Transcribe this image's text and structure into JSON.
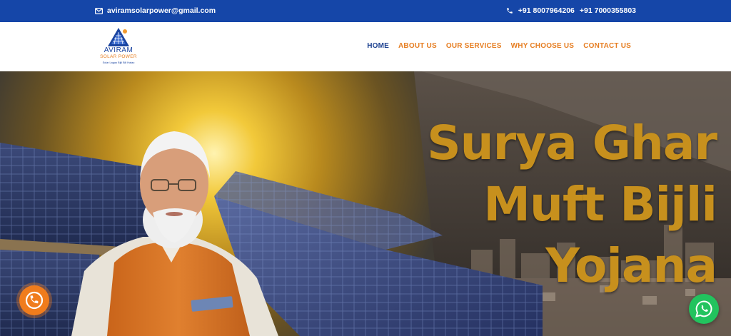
{
  "topbar": {
    "email": "aviramsolarpower@gmail.com",
    "phone1": "+91 8007964206",
    "phone2": "+91 7000355803",
    "email_icon": "envelope-icon",
    "phone_icon": "phone-icon"
  },
  "logo": {
    "name": "AVIRAM",
    "subtitle": "SOLAR POWER",
    "tagline": "Solar Lagao Bijli Bill Hatao"
  },
  "nav": {
    "items": [
      {
        "label": "HOME",
        "active": true
      },
      {
        "label": "ABOUT US",
        "active": false
      },
      {
        "label": "OUR SERVICES",
        "active": false
      },
      {
        "label": "WHY CHOOSE US",
        "active": false
      },
      {
        "label": "CONTACT US",
        "active": false
      }
    ]
  },
  "hero": {
    "title_line1": "Surya Ghar",
    "title_line2": "Muft Bijli",
    "title_line3": "Yojana"
  },
  "floating": {
    "call_icon": "phone-call-icon",
    "whatsapp_icon": "whatsapp-icon"
  },
  "colors": {
    "topbar_bg": "#1546a8",
    "nav_active": "#1a3f8f",
    "nav_link": "#e67e22",
    "hero_title": "#c7901d",
    "call_button": "#f07c1c",
    "whatsapp_button": "#22c35e"
  }
}
